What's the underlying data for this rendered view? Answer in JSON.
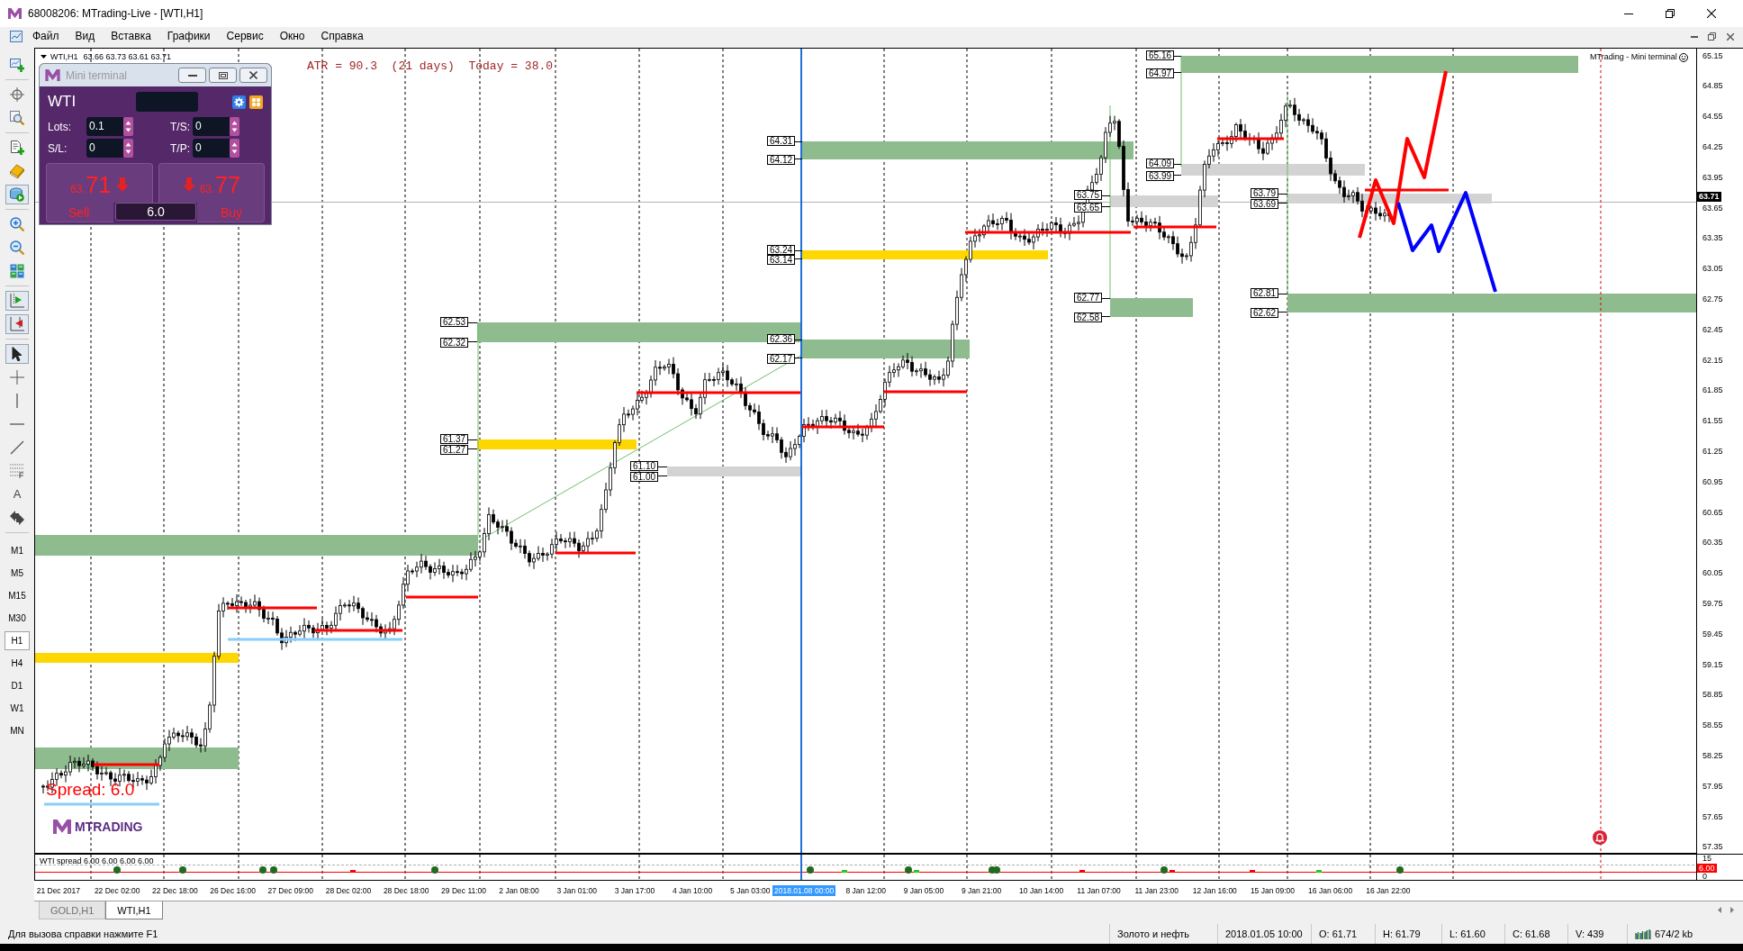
{
  "window": {
    "title": "68008206: MTrading-Live - [WTI,H1]"
  },
  "menu": [
    "Файл",
    "Вид",
    "Вставка",
    "Графики",
    "Сервис",
    "Окно",
    "Справка"
  ],
  "toolbar": {
    "groups": [
      {
        "tools": [
          {
            "kind": "new-chart",
            "pressed": false
          }
        ]
      },
      {
        "tools": [
          {
            "kind": "crosshair",
            "pressed": false
          },
          {
            "kind": "zoom-chart",
            "pressed": false
          }
        ]
      },
      {
        "tools": [
          {
            "kind": "new-order",
            "pressed": false
          },
          {
            "kind": "editor",
            "pressed": false
          },
          {
            "kind": "auto-trading",
            "pressed": true
          }
        ]
      },
      {
        "tools": [
          {
            "kind": "zoom-in",
            "pressed": false
          },
          {
            "kind": "zoom-out",
            "pressed": false
          },
          {
            "kind": "tile",
            "pressed": false
          }
        ]
      },
      {
        "tools": [
          {
            "kind": "chart-shift",
            "pressed": true
          },
          {
            "kind": "autoscroll",
            "pressed": true
          }
        ]
      },
      {
        "tools": [
          {
            "kind": "cursor",
            "pressed": true
          },
          {
            "kind": "cross",
            "pressed": false
          },
          {
            "kind": "vertical-line",
            "pressed": false
          },
          {
            "kind": "horizontal-line",
            "pressed": false
          },
          {
            "kind": "trend-line",
            "pressed": false
          },
          {
            "kind": "fibonacci",
            "pressed": false
          },
          {
            "kind": "text",
            "label": "A",
            "pressed": false
          },
          {
            "kind": "arrows",
            "pressed": false
          }
        ]
      }
    ],
    "timeframes": [
      {
        "label": "M1",
        "selected": false
      },
      {
        "label": "M5",
        "selected": false
      },
      {
        "label": "M15",
        "selected": false
      },
      {
        "label": "M30",
        "selected": false
      },
      {
        "label": "H1",
        "selected": true
      },
      {
        "label": "H4",
        "selected": false
      },
      {
        "label": "D1",
        "selected": false
      },
      {
        "label": "W1",
        "selected": false
      },
      {
        "label": "MN",
        "selected": false
      }
    ]
  },
  "chart": {
    "header": {
      "symbol": "WTI,H1",
      "ohlc": "63.66 63.73 63.61 63.71"
    },
    "indicator_text": "ATR = 90.3  (21 days)  Today = 38.0",
    "corner_label": "MTrading - Mini terminal",
    "zones": [
      {
        "color": "#8fbc8f",
        "top_label": "65.16",
        "bottom_label": "64.97"
      },
      {
        "color": "#8fbc8f",
        "top_label": "64.31",
        "bottom_label": "64.12"
      },
      {
        "color": "#8fbc8f",
        "top_label": "62.53",
        "bottom_label": "62.32"
      },
      {
        "color": "#8fbc8f",
        "top_label": "62.36",
        "bottom_label": "62.17"
      },
      {
        "color": "#8fbc8f",
        "top_label": "62.77",
        "bottom_label": "62.58"
      },
      {
        "color": "#8fbc8f",
        "top_label": "62.81",
        "bottom_label": "62.62"
      },
      {
        "color": "#8fbc8f"
      },
      {
        "color": "#8fbc8f"
      },
      {
        "color": "#ffd700",
        "top_label": "61.37",
        "bottom_label": "61.27"
      },
      {
        "color": "#ffd700",
        "top_label": "63.24",
        "bottom_label": "63.14"
      },
      {
        "color": "#ffd700"
      },
      {
        "color": "#d3d3d3",
        "top_label": "61.10",
        "bottom_label": "61.00"
      },
      {
        "color": "#d3d3d3",
        "top_label": "64.09",
        "bottom_label": "63.99"
      },
      {
        "color": "#d3d3d3",
        "top_label": "63.75",
        "bottom_label": "63.65"
      },
      {
        "color": "#d3d3d3",
        "top_label": "63.79",
        "bottom_label": "63.69"
      }
    ],
    "spread_label": "Spread: 6.0",
    "logo_text": "MTRADING",
    "price_axis": [
      "65.15",
      "64.85",
      "64.55",
      "64.25",
      "63.95",
      "63.65",
      "63.35",
      "63.05",
      "62.75",
      "62.45",
      "62.15",
      "61.85",
      "61.55",
      "61.25",
      "60.95",
      "60.65",
      "60.35",
      "60.05",
      "59.75",
      "59.45",
      "59.15",
      "58.85",
      "58.55",
      "58.25",
      "57.95",
      "57.65",
      "57.35"
    ],
    "current_price": "63.71",
    "time_axis": [
      {
        "label": "21 Dec 2017",
        "highlighted": false
      },
      {
        "label": "22 Dec 02:00",
        "highlighted": false
      },
      {
        "label": "22 Dec 18:00",
        "highlighted": false
      },
      {
        "label": "26 Dec 16:00",
        "highlighted": false
      },
      {
        "label": "27 Dec 09:00",
        "highlighted": false
      },
      {
        "label": "28 Dec 02:00",
        "highlighted": false
      },
      {
        "label": "28 Dec 18:00",
        "highlighted": false
      },
      {
        "label": "29 Dec 11:00",
        "highlighted": false
      },
      {
        "label": "2 Jan 08:00",
        "highlighted": false
      },
      {
        "label": "3 Jan 01:00",
        "highlighted": false
      },
      {
        "label": "3 Jan 17:00",
        "highlighted": false
      },
      {
        "label": "4 Jan 10:00",
        "highlighted": false
      },
      {
        "label": "5 Jan 03:00",
        "highlighted": false
      },
      {
        "label": "2018.01.08 00:00",
        "highlighted": true
      },
      {
        "label": "8 Jan 12:00",
        "highlighted": false
      },
      {
        "label": "9 Jan 05:00",
        "highlighted": false
      },
      {
        "label": "9 Jan 21:00",
        "highlighted": false
      },
      {
        "label": "10 Jan 14:00",
        "highlighted": false
      },
      {
        "label": "11 Jan 07:00",
        "highlighted": false
      },
      {
        "label": "11 Jan 23:00",
        "highlighted": false
      },
      {
        "label": "12 Jan 16:00",
        "highlighted": false
      },
      {
        "label": "15 Jan 09:00",
        "highlighted": false
      },
      {
        "label": "16 Jan 06:00",
        "highlighted": false
      },
      {
        "label": "16 Jan 22:00",
        "highlighted": false
      }
    ],
    "subwindow": {
      "label": "WTI spread 6.00 6.00 6.00 6.00",
      "axis": [
        "15",
        "0"
      ],
      "current": "6.00"
    }
  },
  "mini_terminal": {
    "title": "Mini terminal",
    "symbol": "WTI",
    "fields": [
      {
        "label": "Lots:",
        "value": "0.1"
      },
      {
        "label": "T/S:",
        "value": "0"
      },
      {
        "label": "S/L:",
        "value": "0"
      },
      {
        "label": "T/P:",
        "value": "0"
      }
    ],
    "sell": {
      "label": "Sell",
      "price_prefix": "63.",
      "price_main": "71"
    },
    "buy": {
      "label": "Buy",
      "price_prefix": "63.",
      "price_main": "77"
    },
    "spread": "6.0"
  },
  "tabs": [
    {
      "label": "GOLD,H1",
      "selected": false
    },
    {
      "label": "WTI,H1",
      "selected": true
    }
  ],
  "status_bar": {
    "help": "Для вызова справки нажмите F1",
    "fields": [
      "Золото и нефть",
      "2018.01.05 10:00",
      "O: 61.71",
      "H: 61.79",
      "L: 61.60",
      "C: 61.68",
      "V: 439"
    ],
    "traffic": "674/2 kb"
  }
}
